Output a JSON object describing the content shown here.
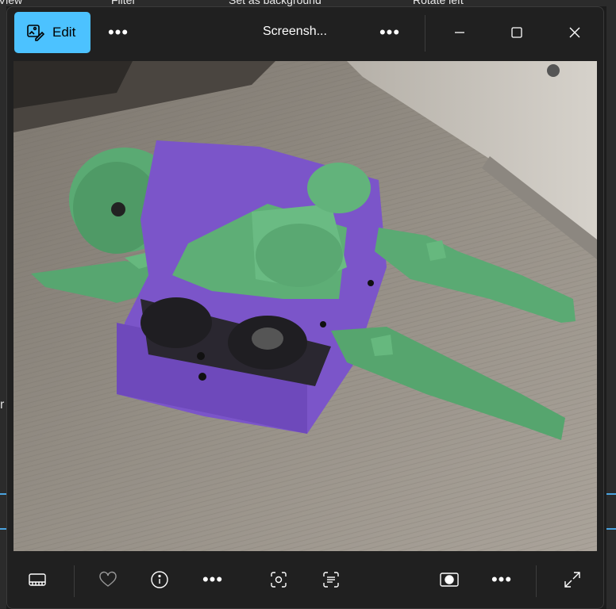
{
  "background_app": {
    "items": [
      "View",
      "Filter",
      "Set as background",
      "Rotate left"
    ],
    "left_fragment": "r"
  },
  "titlebar": {
    "edit_label": "Edit",
    "title": "Screensh..."
  },
  "colors": {
    "accent": "#4cc2ff",
    "window_bg": "#202020",
    "surface": "#8d877f",
    "robot_green": "#5fb07a",
    "robot_purple": "#7a55c8"
  },
  "toolbar": {
    "icons": [
      "filmstrip-icon",
      "favorite-heart-icon",
      "info-icon",
      "more-icon",
      "visual-search-icon",
      "text-scan-icon",
      "background-blur-icon",
      "more-icon",
      "fullscreen-icon"
    ]
  }
}
